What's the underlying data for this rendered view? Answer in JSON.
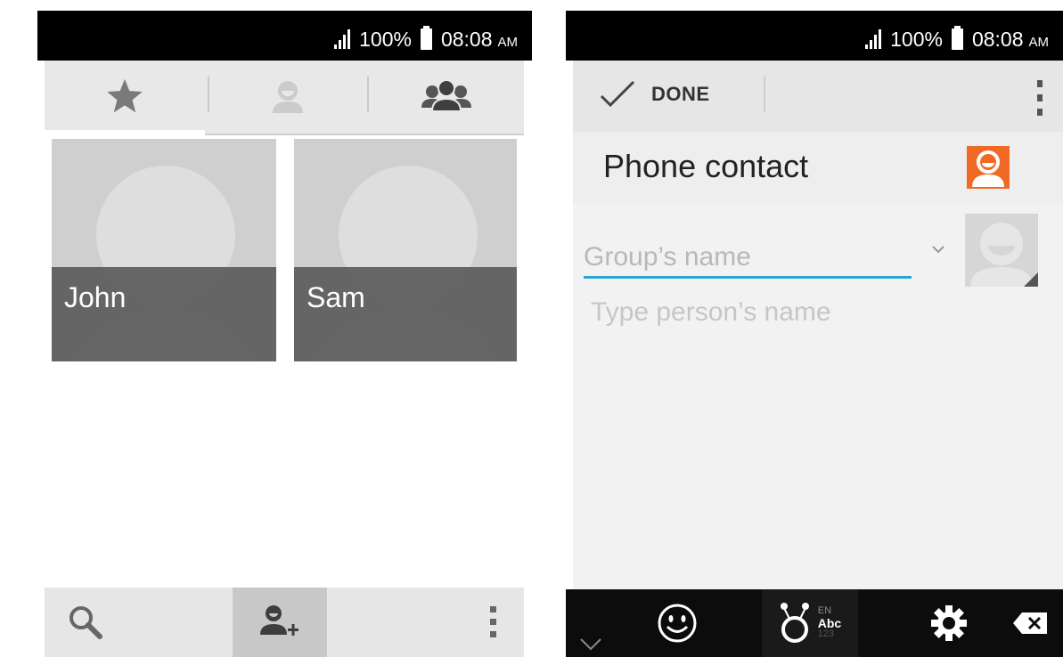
{
  "left_screen": {
    "status": {
      "battery_percent": "100%",
      "time": "08:08",
      "ampm": "AM"
    },
    "tabs": [
      {
        "icon": "star-icon"
      },
      {
        "icon": "person-icon"
      },
      {
        "icon": "group-icon"
      }
    ],
    "contacts": [
      {
        "name": "John"
      },
      {
        "name": "Sam"
      }
    ],
    "bottom_bar": [
      {
        "icon": "search-icon"
      },
      {
        "icon": "add-contact-icon"
      },
      {
        "icon": "overflow-menu-icon"
      }
    ]
  },
  "right_screen": {
    "status": {
      "battery_percent": "100%",
      "time": "08:08",
      "ampm": "AM"
    },
    "action_bar": {
      "done_label": "DONE"
    },
    "account": {
      "name": "Phone contact",
      "icon": "contact-account-icon",
      "icon_color": "#f06a25"
    },
    "form": {
      "group_name_placeholder": "Group’s name",
      "person_name_placeholder": "Type person’s name"
    },
    "keyboard": [
      {
        "icon": "collapse-keyboard-icon"
      },
      {
        "icon": "emoji-icon"
      },
      {
        "icon": "input-method-icon",
        "lines": [
          "EN",
          "Abc",
          "123"
        ]
      },
      {
        "icon": "settings-icon"
      },
      {
        "icon": "backspace-icon"
      }
    ],
    "accent_color": "#2aa6d6"
  }
}
